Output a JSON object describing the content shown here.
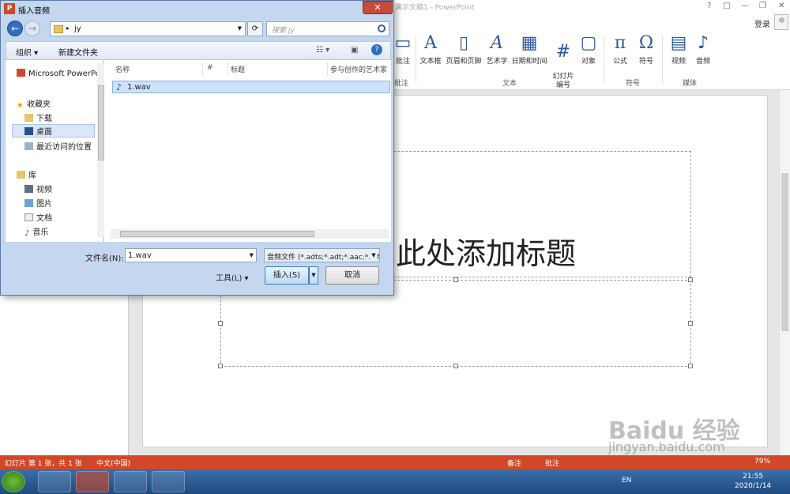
{
  "ppt": {
    "title": "演示文稿1 - PowerPoint",
    "window_controls": [
      "?",
      "□",
      "—",
      "❐",
      "✕"
    ],
    "signin": "登录",
    "ribbon": {
      "buttons": [
        "批注",
        "文本框",
        "页眉和页脚",
        "艺术字",
        "日期和时间",
        "幻灯片\n编号",
        "对象",
        "公式",
        "符号",
        "视频",
        "音频"
      ],
      "groups": [
        "批注",
        "文本",
        "符号",
        "媒体"
      ]
    },
    "slide": {
      "title_placeholder": "单击此处添加标题"
    },
    "status": {
      "slide_info": "幻灯片 第 1 张，共 1 张",
      "language": "中文(中国)",
      "notes": "备注",
      "comments": "批注",
      "zoom": "79%"
    },
    "clock": {
      "time": "21:55",
      "date": "2020/1/14"
    },
    "tray_lang": "EN"
  },
  "dialog": {
    "title": "插入音频",
    "address_path": "jy",
    "search_placeholder": "搜索 jy",
    "commands": {
      "organize": "组织 ▾",
      "new_folder": "新建文件夹"
    },
    "nav": {
      "app": "Microsoft PowerPoint",
      "favorites": "收藏夹",
      "downloads": "下载",
      "desktop": "桌面",
      "recent": "最近访问的位置",
      "libraries": "库",
      "videos": "视频",
      "pictures": "图片",
      "documents": "文档",
      "music": "音乐"
    },
    "columns": {
      "name": "名称",
      "number": "#",
      "title": "标题",
      "artists": "参与创作的艺术家"
    },
    "files": [
      {
        "name": "1.wav"
      }
    ],
    "filename_label": "文件名(N):",
    "filename_value": "1.wav",
    "filter": "音频文件 (*.adts;*.adt;*.aac;*.aif",
    "tools": "工具(L)",
    "insert": "插入(S)",
    "cancel": "取消"
  },
  "watermark": {
    "brand": "Baidu 经验",
    "url": "jingyan.baidu.com"
  },
  "colors": {
    "accent": "#d24726",
    "selection": "#cfe2fb",
    "taskbar": "#1e4a80"
  }
}
